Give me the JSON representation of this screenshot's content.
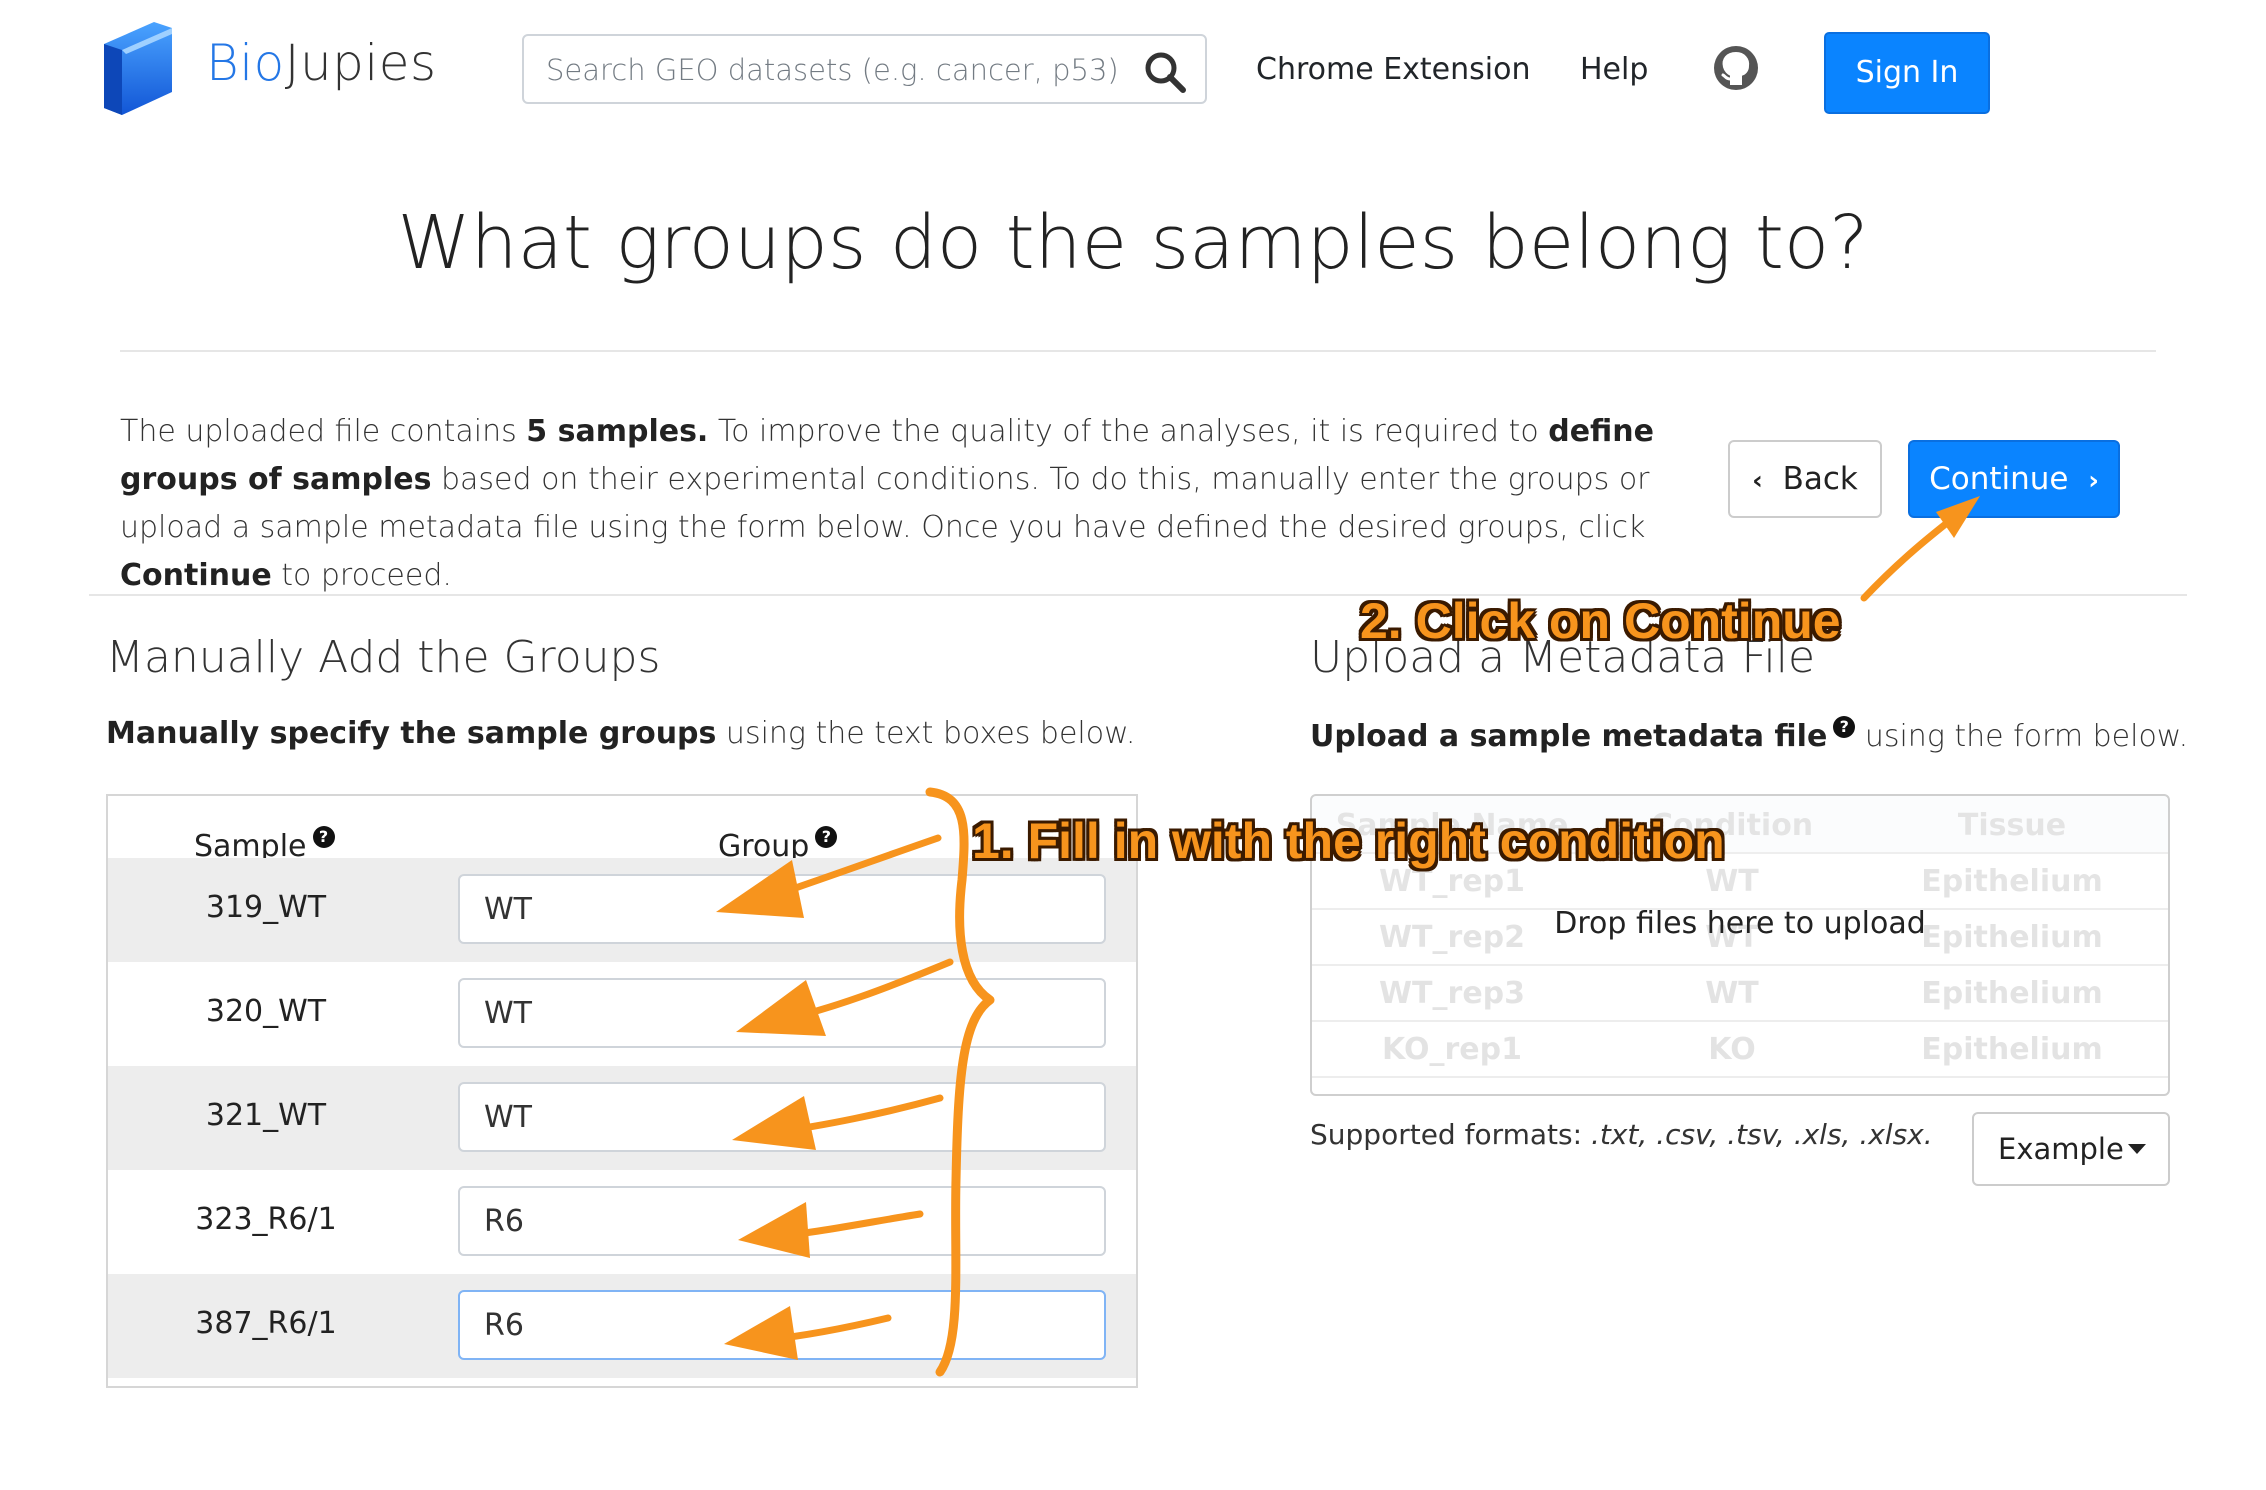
{
  "brand": {
    "part1": "Bio",
    "part2": "Jupies"
  },
  "search": {
    "placeholder": "Search GEO datasets (e.g. cancer, p53)",
    "value": ""
  },
  "nav": {
    "chrome_extension": "Chrome Extension",
    "help": "Help",
    "sign_in": "Sign In"
  },
  "page": {
    "title": "What groups do the samples belong to?",
    "intro": {
      "t1": "The uploaded file contains ",
      "b1": "5 samples.",
      "t2": " To improve the quality of the analyses, it is required to ",
      "b2": "define groups of samples",
      "t3": " based on their experimental conditions. To do this, manually enter the groups or upload a sample metadata file using the form below. Once you have defined the desired groups, click ",
      "b3": "Continue",
      "t4": " to proceed."
    },
    "back_label": "Back",
    "continue_label": "Continue"
  },
  "manual": {
    "heading": "Manually Add the Groups",
    "sub_bold": "Manually specify the sample groups",
    "sub_rest": " using the text boxes below.",
    "col_sample": "Sample",
    "col_group": "Group",
    "rows": [
      {
        "sample": "319_WT",
        "group": "WT"
      },
      {
        "sample": "320_WT",
        "group": "WT"
      },
      {
        "sample": "321_WT",
        "group": "WT"
      },
      {
        "sample": "323_R6/1",
        "group": "R6"
      },
      {
        "sample": "387_R6/1",
        "group": "R6"
      }
    ]
  },
  "upload": {
    "heading": "Upload a Metadata File",
    "sub_bold": "Upload a sample metadata file",
    "sub_rest": " using the form below.",
    "drop_text": "Drop files here to upload",
    "formats_label": "Supported formats: ",
    "formats_list": ".txt, .csv, .tsv, .xls, .xlsx.",
    "example_label": "Example",
    "ghost_header": [
      "Sample Name",
      "Condition",
      "Tissue"
    ],
    "ghost_rows": [
      [
        "WT_rep1",
        "WT",
        "Epithelium"
      ],
      [
        "WT_rep2",
        "WT",
        "Epithelium"
      ],
      [
        "WT_rep3",
        "WT",
        "Epithelium"
      ],
      [
        "KO_rep1",
        "KO",
        "Epithelium"
      ]
    ]
  },
  "help_mark": "?",
  "annotations": {
    "step1": "1. Fill in with the right condition",
    "step2": "2. Click on Continue"
  },
  "colors": {
    "primary": "#0a84ff",
    "annotation": "#f7941d",
    "brand_blue": "#2477e6"
  }
}
